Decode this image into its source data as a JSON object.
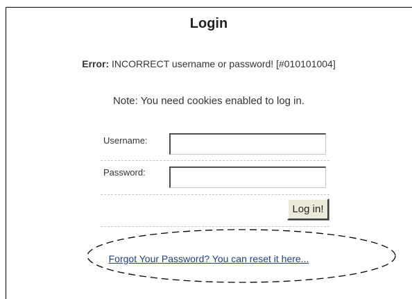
{
  "login": {
    "title": "Login",
    "error_prefix": "Error:",
    "error_message": " INCORRECT username or password! [#010101004]",
    "note": "Note: You need cookies enabled to log in.",
    "username_label": "Username:",
    "username_value": "",
    "password_label": "Password:",
    "password_value": "",
    "login_button": "Log in!",
    "forgot_link": "Forgot Your Password? You can reset it here..."
  },
  "colors": {
    "link": "#1d3f8a",
    "button_face": "#ece9d8",
    "annotation_ellipse": "#000000"
  }
}
